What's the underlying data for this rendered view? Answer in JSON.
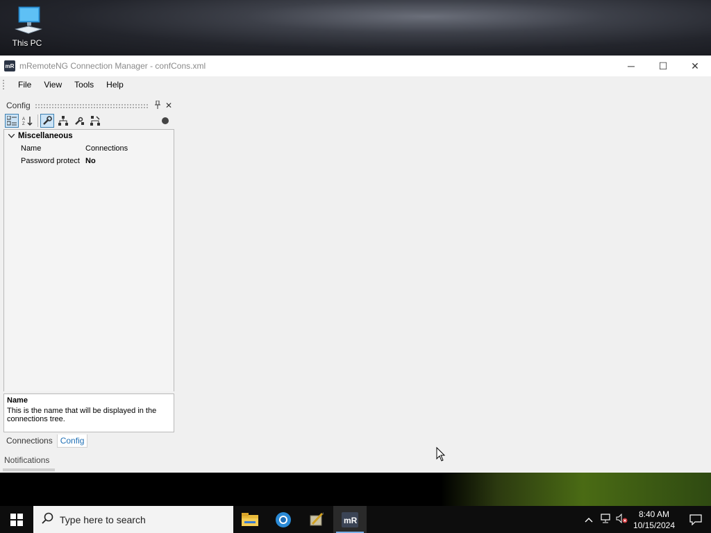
{
  "desktop": {
    "icons": [
      {
        "label": "This PC",
        "icon": "computer-icon"
      }
    ]
  },
  "window": {
    "title": "mRemoteNG Connection Manager - confCons.xml",
    "app_icon_text": "mR",
    "controls": {
      "minimize": "─",
      "maximize": "☐",
      "close": "✕"
    }
  },
  "menu": {
    "items": [
      "File",
      "View",
      "Tools",
      "Help"
    ]
  },
  "config_panel": {
    "title": "Config",
    "pin": "📌",
    "close": "✕",
    "toolbar": [
      {
        "icon": "categorized-icon",
        "active": true
      },
      {
        "icon": "alphabetical-sort-icon",
        "active": false
      },
      {
        "icon": "properties-wrench-icon",
        "active": true
      },
      {
        "icon": "inheritance-tree-icon",
        "active": false
      },
      {
        "icon": "default-properties-icon",
        "active": false
      },
      {
        "icon": "default-inheritance-icon",
        "active": false
      }
    ],
    "category": {
      "label": "Miscellaneous",
      "expanded": true
    },
    "properties": [
      {
        "name": "Name",
        "value": "Connections",
        "bold": false
      },
      {
        "name": "Password protect",
        "value": "No",
        "bold": true
      }
    ],
    "description": {
      "title": "Name",
      "text": "This is the name that will be displayed in the connections tree."
    },
    "tabs": [
      {
        "label": "Connections",
        "active": false
      },
      {
        "label": "Config",
        "active": true
      }
    ]
  },
  "notifications": {
    "label": "Notifications"
  },
  "taskbar": {
    "search_placeholder": "Type here to search",
    "apps": [
      {
        "name": "file-explorer-icon",
        "active": false
      },
      {
        "name": "browser-icon",
        "active": false
      },
      {
        "name": "app-icon",
        "active": false
      },
      {
        "name": "mremoteng-icon",
        "active": true
      }
    ],
    "clock": {
      "time": "8:40 AM",
      "date": "10/15/2024"
    },
    "colors": {
      "taskbar": "#0d0d0d",
      "accent": "#1e6fb5"
    }
  }
}
